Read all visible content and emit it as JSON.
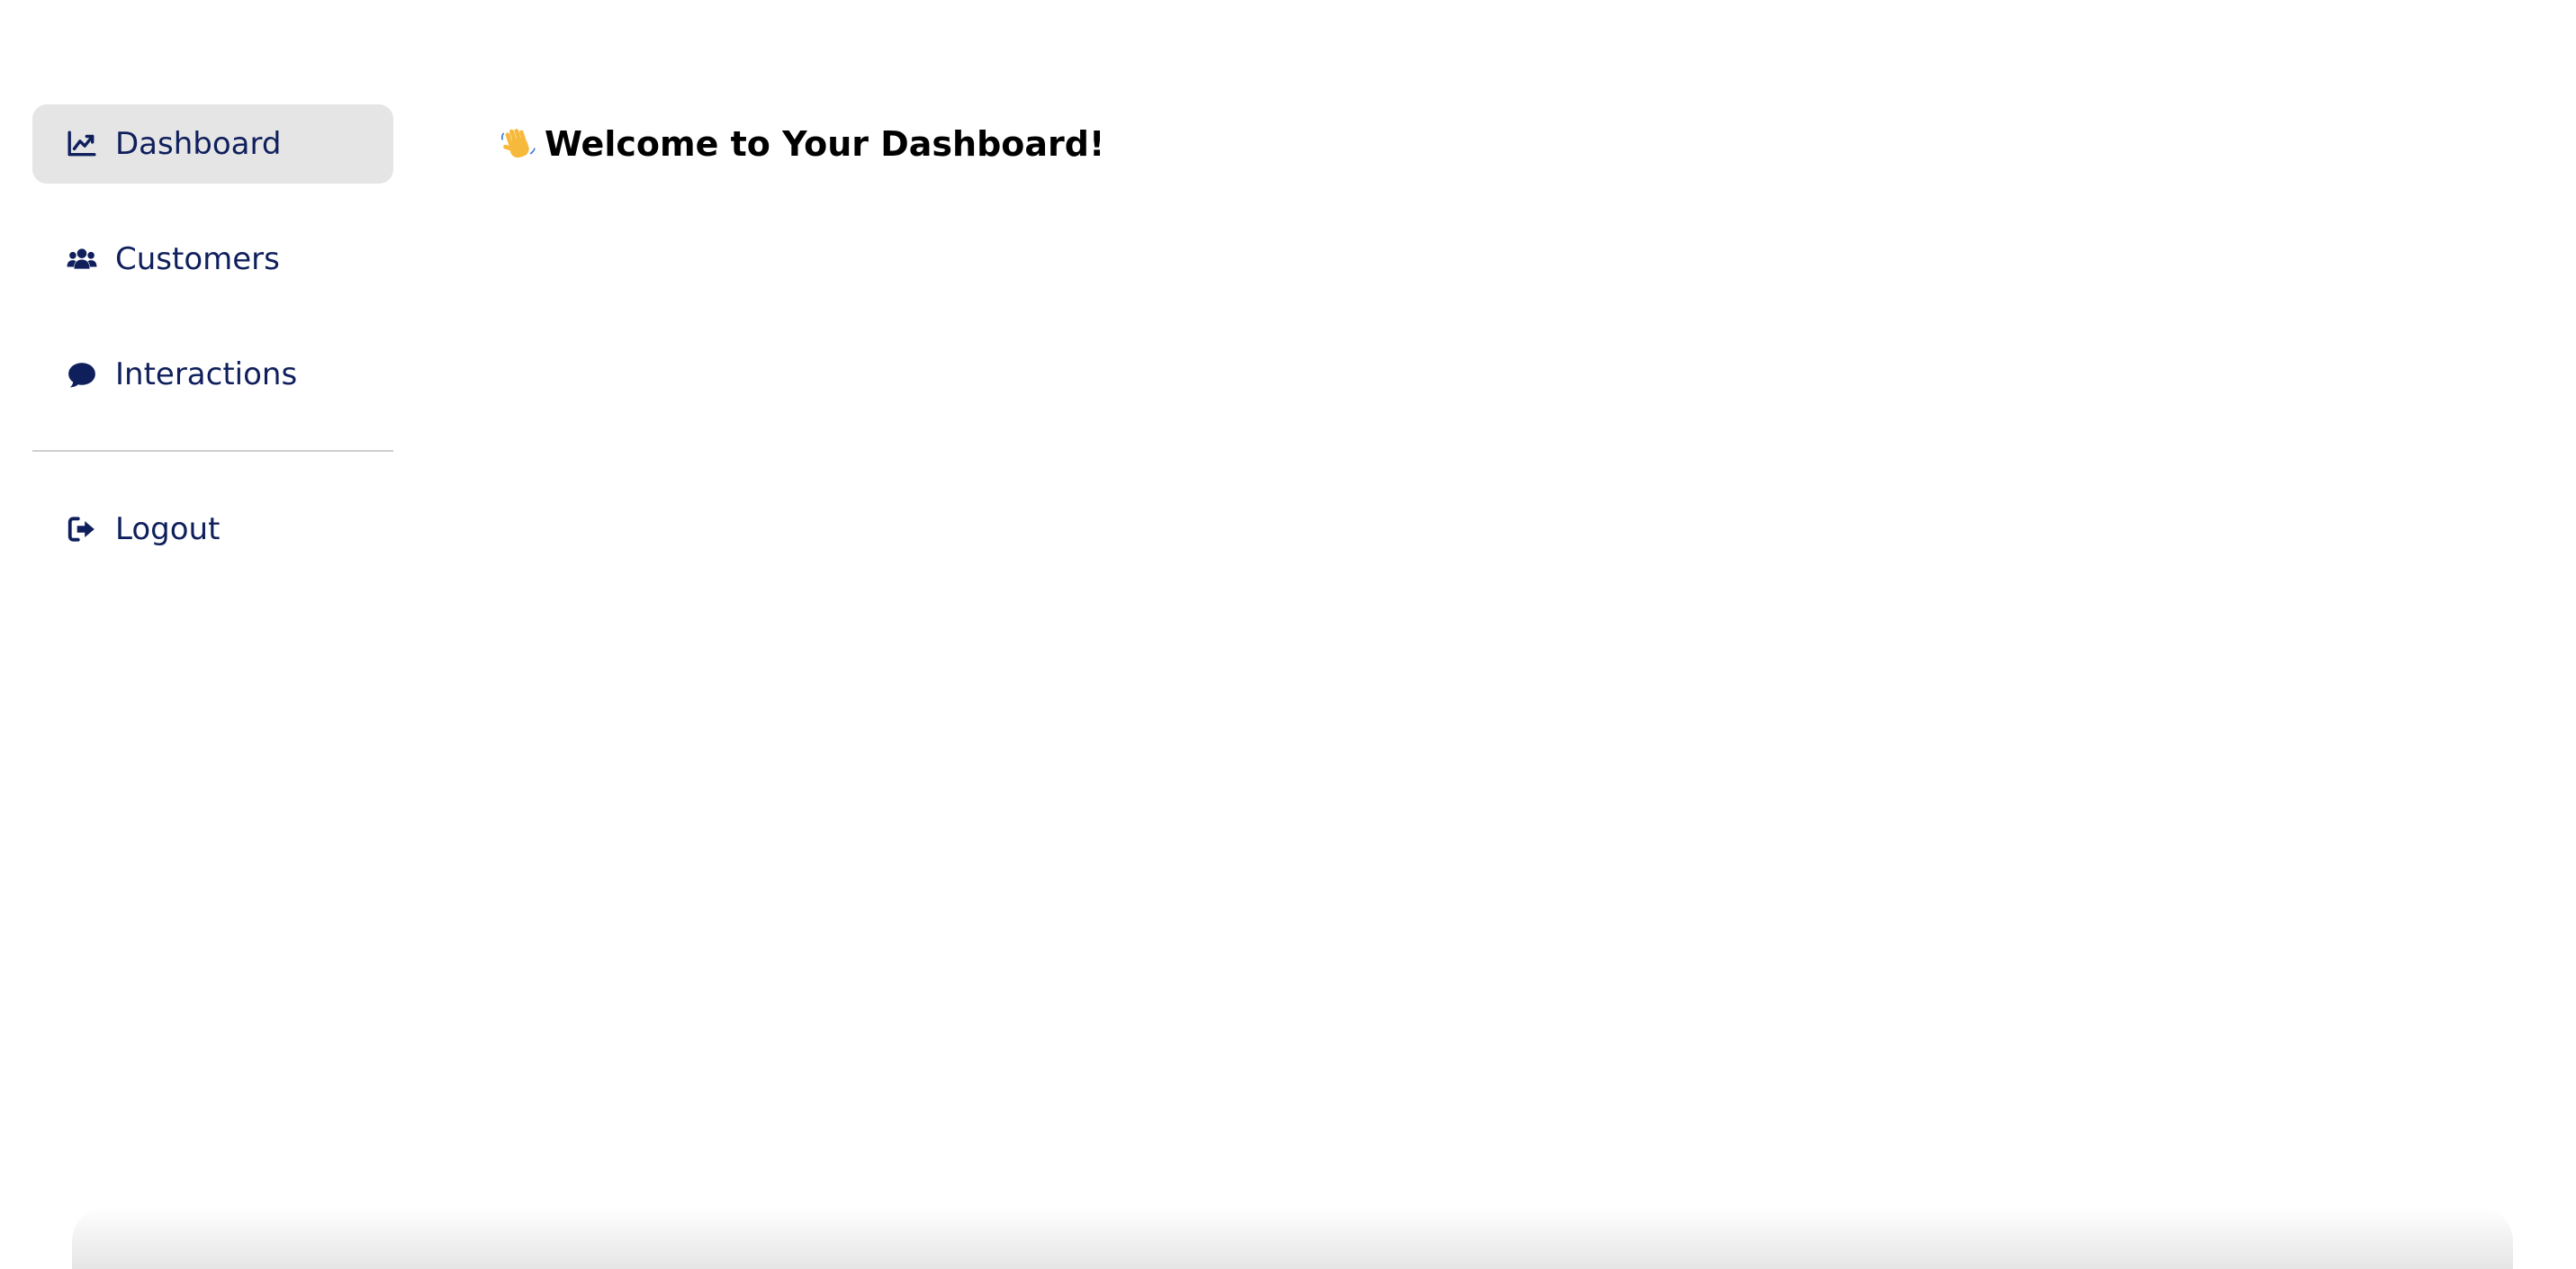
{
  "sidebar": {
    "items": [
      {
        "label": "Dashboard",
        "icon": "chart-line-icon",
        "active": true
      },
      {
        "label": "Customers",
        "icon": "users-icon",
        "active": false
      },
      {
        "label": "Interactions",
        "icon": "comment-icon",
        "active": false
      }
    ],
    "logout": {
      "label": "Logout",
      "icon": "sign-out-icon"
    }
  },
  "main": {
    "greeting_icon": "waving-hand-icon",
    "title": "Welcome to Your Dashboard!"
  },
  "colors": {
    "nav_text": "#0f1f5c",
    "active_bg": "#e5e5e5",
    "title_text": "#000000",
    "background": "#ffffff"
  }
}
